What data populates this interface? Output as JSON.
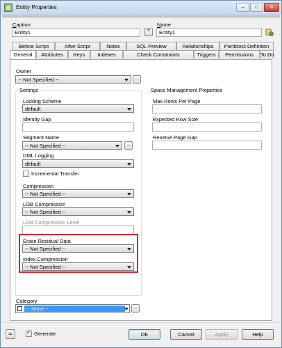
{
  "window": {
    "title": "Entity Properties",
    "controls": {
      "minimize": "–",
      "maximize": "□",
      "close": "✕"
    }
  },
  "caption": {
    "label": "Caption",
    "underline": "C",
    "rest": "aption",
    "value": "Entity1"
  },
  "name": {
    "label": "Name",
    "underline": "N",
    "rest": "ame",
    "value": "Entity1"
  },
  "sync_button": "=",
  "tabs_back": [
    "Before Script",
    "After Script",
    "Notes",
    "SQL Preview",
    "Relationships",
    "Partitions Definition"
  ],
  "tabs_front": [
    "General",
    "Attributes",
    "Keys",
    "Indexes",
    "Check Constraints",
    "Triggers",
    "Permissions",
    "To Do"
  ],
  "owner": {
    "label": "Owner",
    "value": "-- Not Specified --"
  },
  "settings": {
    "title": "Settings",
    "locking_scheme": {
      "label": "Locking Scheme",
      "value": "default"
    },
    "identity_gap": {
      "label": "Identity Gap",
      "value": ""
    },
    "segment_name": {
      "label": "Segment Name",
      "value": "-- Not Specified --"
    },
    "dml_logging": {
      "label": "DML Logging",
      "value": "default"
    },
    "incremental_transfer": {
      "label": "Incremental Transfer",
      "checked": false
    },
    "compression": {
      "label": "Compression",
      "value": "-- Not Specified --"
    },
    "lob_compression": {
      "label": "LOB Compression",
      "value": "-- Not Specified --"
    },
    "lob_compression_level": {
      "label": "LOB Compression Level",
      "value": ""
    },
    "erase_residual_data": {
      "label": "Erase Residual Data",
      "value": "-- Not Specified --"
    },
    "index_compression": {
      "label": "Index Compression",
      "value": "-- Not Specified --"
    }
  },
  "space": {
    "title": "Space Management Properties",
    "max_rows_per_page": {
      "label": "Max Rows Per Page",
      "value": ""
    },
    "expected_row_size": {
      "label": "Expected Row Size",
      "value": ""
    },
    "reserve_page_gap": {
      "label": "Reserve Page Gap",
      "value": ""
    }
  },
  "category": {
    "label": "Category",
    "value": "-- None --"
  },
  "footer": {
    "generate_label": "Generate",
    "generate_checked": true,
    "ok": "OK",
    "cancel": "Cancel",
    "apply": "Apply",
    "help": "Help"
  },
  "colors": {
    "highlight": "#e0202b",
    "selection": "#3399ff"
  }
}
